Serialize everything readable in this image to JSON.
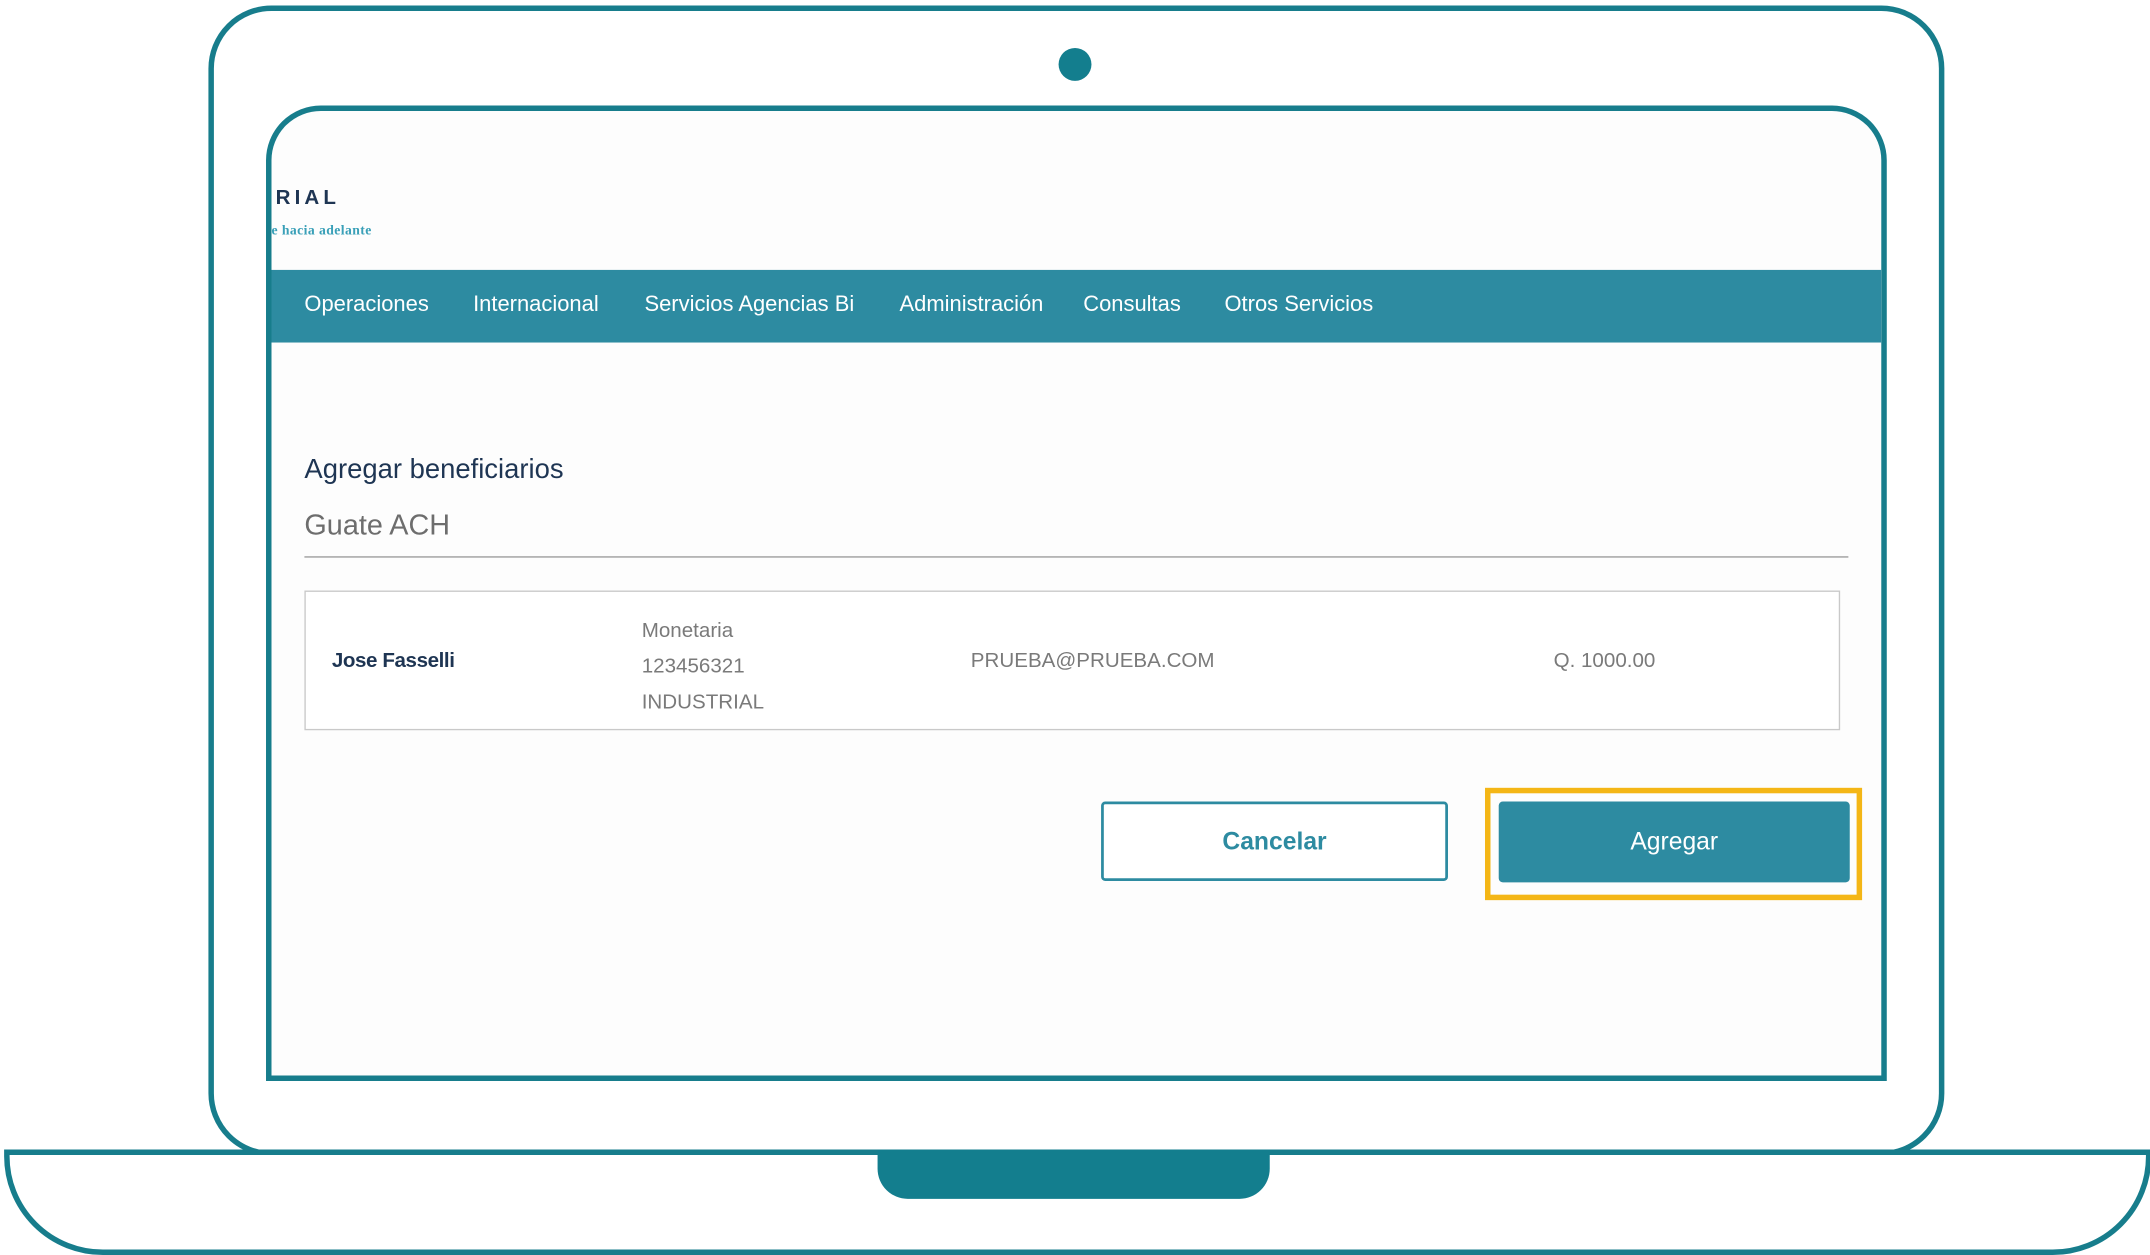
{
  "logo": {
    "text": "RIAL",
    "tagline": "e hacia adelante"
  },
  "nav": {
    "items": [
      {
        "label": "Operaciones"
      },
      {
        "label": "Internacional"
      },
      {
        "label": "Servicios Agencias Bi"
      },
      {
        "label": "Administración"
      },
      {
        "label": "Consultas"
      },
      {
        "label": "Otros Servicios"
      }
    ]
  },
  "page": {
    "title": "Agregar beneficiarios",
    "subtitle": "Guate ACH"
  },
  "beneficiary": {
    "name": "Jose Fasselli",
    "account_type": "Monetaria",
    "account_number": "123456321",
    "bank": "INDUSTRIAL",
    "email": "PRUEBA@PRUEBA.COM",
    "amount": "Q. 1000.00"
  },
  "actions": {
    "cancel_label": "Cancelar",
    "add_label": "Agregar"
  },
  "colors": {
    "frame": "#177d8c",
    "accent": "#2d8ba1",
    "highlight": "#f4b616",
    "title": "#1e3553"
  }
}
